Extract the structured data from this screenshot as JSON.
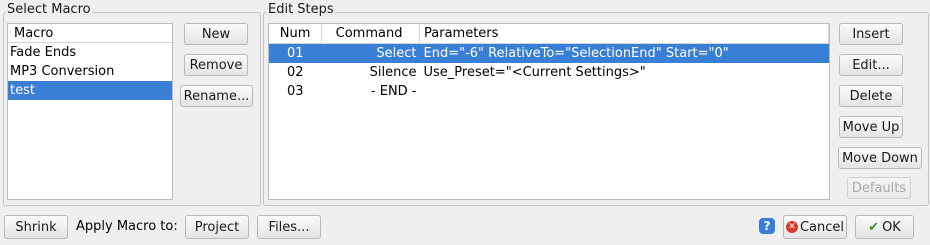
{
  "select_macro": {
    "title": "Select Macro",
    "list_header": "Macro",
    "items": [
      "Fade Ends",
      "MP3 Conversion",
      "test"
    ],
    "selected_index": 2,
    "buttons": {
      "new": "New",
      "remove": "Remove",
      "rename": "Rename..."
    }
  },
  "edit_steps": {
    "title": "Edit Steps",
    "columns": [
      "Num",
      "Command",
      "Parameters"
    ],
    "rows": [
      {
        "num": "01",
        "command": "Select",
        "parameters": "End=\"-6\" RelativeTo=\"SelectionEnd\" Start=\"0\""
      },
      {
        "num": "02",
        "command": "Silence",
        "parameters": "Use_Preset=\"<Current Settings>\""
      },
      {
        "num": "03",
        "command": "- END -",
        "parameters": ""
      }
    ],
    "selected_row": 0,
    "buttons": {
      "insert": "Insert",
      "edit": "Edit...",
      "delete": "Delete",
      "move_up": "Move Up",
      "move_down": "Move Down",
      "defaults": "Defaults"
    }
  },
  "bottom": {
    "shrink": "Shrink",
    "apply_label": "Apply Macro to:",
    "project": "Project",
    "files": "Files...",
    "help": "?",
    "cancel": "Cancel",
    "ok": "OK"
  },
  "colors": {
    "selection": "#3a7fd6"
  }
}
